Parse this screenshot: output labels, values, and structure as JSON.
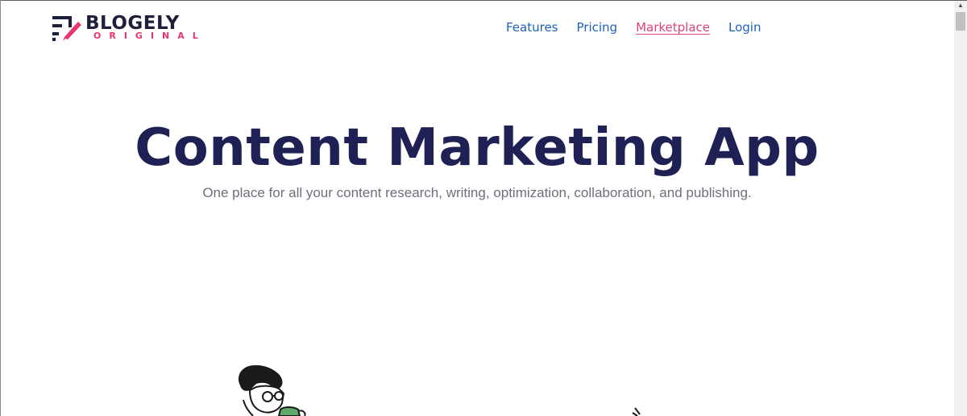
{
  "brand": {
    "name": "BLOGELY",
    "subtitle": "ORIGINAL",
    "colors": {
      "navy": "#1e1f3a",
      "pink": "#e6356f"
    }
  },
  "nav": {
    "items": [
      {
        "label": "Features",
        "active": false
      },
      {
        "label": "Pricing",
        "active": false
      },
      {
        "label": "Marketplace",
        "active": true
      },
      {
        "label": "Login",
        "active": false
      }
    ],
    "link_color": "#1f63b5",
    "active_color": "#d9437d"
  },
  "hero": {
    "title": "Content Marketing App",
    "subtitle": "One place for all your content research, writing, optimization, collaboration, and publishing.",
    "title_color": "#1f2155"
  },
  "icons": {
    "logo": "pen-lines-logo-icon",
    "illustration": "person-at-desk-illustration"
  }
}
